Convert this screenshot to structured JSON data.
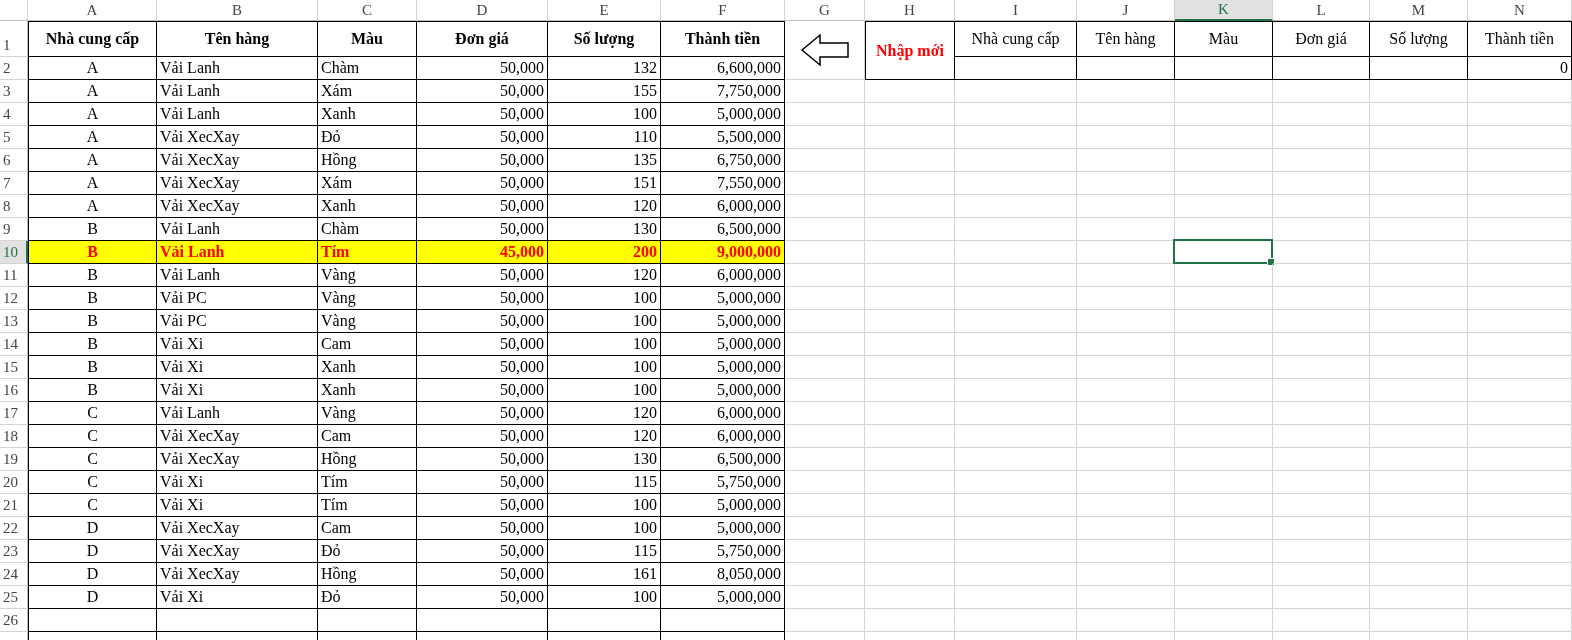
{
  "column_headers": [
    {
      "label": "A",
      "selected": false
    },
    {
      "label": "B",
      "selected": false
    },
    {
      "label": "C",
      "selected": false
    },
    {
      "label": "D",
      "selected": false
    },
    {
      "label": "E",
      "selected": false
    },
    {
      "label": "F",
      "selected": false
    },
    {
      "label": "G",
      "selected": false
    },
    {
      "label": "H",
      "selected": false
    },
    {
      "label": "I",
      "selected": false
    },
    {
      "label": "J",
      "selected": false
    },
    {
      "label": "K",
      "selected": true
    },
    {
      "label": "L",
      "selected": false
    },
    {
      "label": "M",
      "selected": false
    },
    {
      "label": "N",
      "selected": false
    }
  ],
  "row_headers": [
    {
      "label": "1",
      "selected": false
    },
    {
      "label": "2",
      "selected": false
    },
    {
      "label": "3",
      "selected": false
    },
    {
      "label": "4",
      "selected": false
    },
    {
      "label": "5",
      "selected": false
    },
    {
      "label": "6",
      "selected": false
    },
    {
      "label": "7",
      "selected": false
    },
    {
      "label": "8",
      "selected": false
    },
    {
      "label": "9",
      "selected": false
    },
    {
      "label": "10",
      "selected": true
    },
    {
      "label": "11",
      "selected": false
    },
    {
      "label": "12",
      "selected": false
    },
    {
      "label": "13",
      "selected": false
    },
    {
      "label": "14",
      "selected": false
    },
    {
      "label": "15",
      "selected": false
    },
    {
      "label": "16",
      "selected": false
    },
    {
      "label": "17",
      "selected": false
    },
    {
      "label": "18",
      "selected": false
    },
    {
      "label": "19",
      "selected": false
    },
    {
      "label": "20",
      "selected": false
    },
    {
      "label": "21",
      "selected": false
    },
    {
      "label": "22",
      "selected": false
    },
    {
      "label": "23",
      "selected": false
    },
    {
      "label": "24",
      "selected": false
    },
    {
      "label": "25",
      "selected": false
    },
    {
      "label": "26",
      "selected": false
    }
  ],
  "supplier_table": {
    "columns": [
      "Nhà cung cấp",
      "Tên hàng",
      "Màu",
      "Đơn giá",
      "Số lượng",
      "Thành tiền"
    ],
    "rows": [
      {
        "cells": [
          "A",
          "Vải Lanh",
          "Chàm",
          "50,000",
          "132",
          "6,600,000"
        ],
        "highlighted": false
      },
      {
        "cells": [
          "A",
          "Vải Lanh",
          "Xám",
          "50,000",
          "155",
          "7,750,000"
        ],
        "highlighted": false
      },
      {
        "cells": [
          "A",
          "Vải Lanh",
          "Xanh",
          "50,000",
          "100",
          "5,000,000"
        ],
        "highlighted": false
      },
      {
        "cells": [
          "A",
          "Vải XecXay",
          "Đỏ",
          "50,000",
          "110",
          "5,500,000"
        ],
        "highlighted": false
      },
      {
        "cells": [
          "A",
          "Vải XecXay",
          "Hồng",
          "50,000",
          "135",
          "6,750,000"
        ],
        "highlighted": false
      },
      {
        "cells": [
          "A",
          "Vải XecXay",
          "Xám",
          "50,000",
          "151",
          "7,550,000"
        ],
        "highlighted": false
      },
      {
        "cells": [
          "A",
          "Vải XecXay",
          "Xanh",
          "50,000",
          "120",
          "6,000,000"
        ],
        "highlighted": false
      },
      {
        "cells": [
          "B",
          "Vải Lanh",
          "Chàm",
          "50,000",
          "130",
          "6,500,000"
        ],
        "highlighted": false
      },
      {
        "cells": [
          "B",
          "Vải Lanh",
          "Tím",
          "45,000",
          "200",
          "9,000,000"
        ],
        "highlighted": true
      },
      {
        "cells": [
          "B",
          "Vải Lanh",
          "Vàng",
          "50,000",
          "120",
          "6,000,000"
        ],
        "highlighted": false
      },
      {
        "cells": [
          "B",
          "Vải PC",
          "Vàng",
          "50,000",
          "100",
          "5,000,000"
        ],
        "highlighted": false
      },
      {
        "cells": [
          "B",
          "Vải PC",
          "Vàng",
          "50,000",
          "100",
          "5,000,000"
        ],
        "highlighted": false
      },
      {
        "cells": [
          "B",
          "Vải Xi",
          "Cam",
          "50,000",
          "100",
          "5,000,000"
        ],
        "highlighted": false
      },
      {
        "cells": [
          "B",
          "Vải Xi",
          "Xanh",
          "50,000",
          "100",
          "5,000,000"
        ],
        "highlighted": false
      },
      {
        "cells": [
          "B",
          "Vải Xi",
          "Xanh",
          "50,000",
          "100",
          "5,000,000"
        ],
        "highlighted": false
      },
      {
        "cells": [
          "C",
          "Vải Lanh",
          "Vàng",
          "50,000",
          "120",
          "6,000,000"
        ],
        "highlighted": false
      },
      {
        "cells": [
          "C",
          "Vải XecXay",
          "Cam",
          "50,000",
          "120",
          "6,000,000"
        ],
        "highlighted": false
      },
      {
        "cells": [
          "C",
          "Vải XecXay",
          "Hồng",
          "50,000",
          "130",
          "6,500,000"
        ],
        "highlighted": false
      },
      {
        "cells": [
          "C",
          "Vải Xi",
          "Tím",
          "50,000",
          "115",
          "5,750,000"
        ],
        "highlighted": false
      },
      {
        "cells": [
          "C",
          "Vải Xi",
          "Tím",
          "50,000",
          "100",
          "5,000,000"
        ],
        "highlighted": false
      },
      {
        "cells": [
          "D",
          "Vải XecXay",
          "Cam",
          "50,000",
          "100",
          "5,000,000"
        ],
        "highlighted": false
      },
      {
        "cells": [
          "D",
          "Vải XecXay",
          "Đỏ",
          "50,000",
          "115",
          "5,750,000"
        ],
        "highlighted": false
      },
      {
        "cells": [
          "D",
          "Vải XecXay",
          "Hồng",
          "50,000",
          "161",
          "8,050,000"
        ],
        "highlighted": false
      },
      {
        "cells": [
          "D",
          "Vải Xi",
          "Đỏ",
          "50,000",
          "100",
          "5,000,000"
        ],
        "highlighted": false
      }
    ]
  },
  "new_entry": {
    "label": "Nhập mới",
    "columns": [
      "Nhà cung cấp",
      "Tên hàng",
      "Màu",
      "Đơn giá",
      "Số lượng",
      "Thành tiền"
    ],
    "total": "0"
  }
}
